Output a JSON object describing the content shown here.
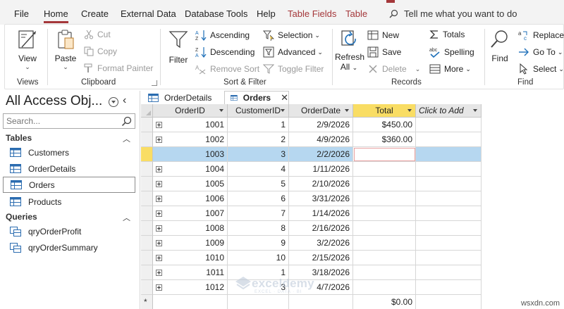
{
  "menu": {
    "items": [
      "File",
      "Home",
      "Create",
      "External Data",
      "Database Tools",
      "Help"
    ],
    "context_items": [
      "Table Fields",
      "Table"
    ],
    "active": "Home",
    "tell_me": "Tell me what you want to do"
  },
  "ribbon": {
    "views": {
      "view_label": "View",
      "group": "Views"
    },
    "clipboard": {
      "paste": "Paste",
      "cut": "Cut",
      "copy": "Copy",
      "format_painter": "Format Painter",
      "group": "Clipboard"
    },
    "sort_filter": {
      "filter": "Filter",
      "ascending": "Ascending",
      "descending": "Descending",
      "remove_sort": "Remove Sort",
      "selection": "Selection",
      "advanced": "Advanced",
      "toggle_filter": "Toggle Filter",
      "group": "Sort & Filter"
    },
    "records": {
      "refresh": "Refresh",
      "refresh_all": "All",
      "new": "New",
      "save": "Save",
      "delete": "Delete",
      "totals": "Totals",
      "spelling": "Spelling",
      "more": "More",
      "group": "Records"
    },
    "find": {
      "find": "Find",
      "replace": "Replace",
      "goto": "Go To",
      "select": "Select",
      "group": "Find"
    }
  },
  "nav": {
    "title": "All Access Obj...",
    "search_placeholder": "Search...",
    "tables_header": "Tables",
    "tables": [
      "Customers",
      "OrderDetails",
      "Orders",
      "Products"
    ],
    "selected_table": "Orders",
    "queries_header": "Queries",
    "queries": [
      "qryOrderProfit",
      "qryOrderSummary"
    ]
  },
  "tabs": [
    {
      "label": "OrderDetails",
      "active": false
    },
    {
      "label": "Orders",
      "active": true
    }
  ],
  "datasheet": {
    "columns": [
      "OrderID",
      "CustomerID",
      "OrderDate",
      "Total",
      "Click to Add"
    ],
    "rows": [
      [
        "1001",
        "1",
        "2/9/2026",
        "$450.00"
      ],
      [
        "1002",
        "2",
        "4/9/2026",
        "$360.00"
      ],
      [
        "1003",
        "3",
        "2/2/2026",
        ""
      ],
      [
        "1004",
        "4",
        "1/11/2026",
        ""
      ],
      [
        "1005",
        "5",
        "2/10/2026",
        ""
      ],
      [
        "1006",
        "6",
        "3/31/2026",
        ""
      ],
      [
        "1007",
        "7",
        "1/14/2026",
        ""
      ],
      [
        "1008",
        "8",
        "2/16/2026",
        ""
      ],
      [
        "1009",
        "9",
        "3/2/2026",
        ""
      ],
      [
        "1010",
        "10",
        "2/15/2026",
        ""
      ],
      [
        "1011",
        "1",
        "3/18/2026",
        ""
      ],
      [
        "1012",
        "3",
        "4/7/2026",
        ""
      ]
    ],
    "current_row_index": 2,
    "new_row_total": "$0.00",
    "new_row_marker": "*"
  },
  "watermark": {
    "text": "exceldemy",
    "sub": "EXCEL · DATA · BI"
  },
  "corner_text": "wsxdn.com",
  "colors": {
    "accent": "#a4373a",
    "total_header": "#f9dd64",
    "current_row": "#b6d7f0"
  }
}
